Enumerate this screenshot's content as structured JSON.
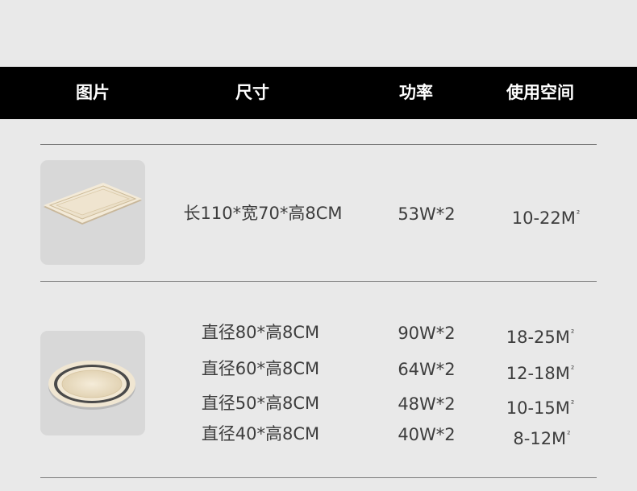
{
  "header": {
    "col_image": "图片",
    "col_size": "尺寸",
    "col_power": "功率",
    "col_space": "使用空间"
  },
  "rows": [
    {
      "image": "rectangular-ceiling-lamp",
      "variants": [
        {
          "size": "长110*宽70*高8CM",
          "power": "53W*2",
          "space": "10-22M",
          "space_unit_sup": "²"
        }
      ]
    },
    {
      "image": "round-ceiling-lamp",
      "variants": [
        {
          "size": "直径80*高8CM",
          "power": "90W*2",
          "space": "18-25M",
          "space_unit_sup": "²"
        },
        {
          "size": "直径60*高8CM",
          "power": "64W*2",
          "space": "12-18M",
          "space_unit_sup": "²"
        },
        {
          "size": "直径50*高8CM",
          "power": "48W*2",
          "space": "10-15M",
          "space_unit_sup": "²"
        },
        {
          "size": "直径40*高8CM",
          "power": "40W*2",
          "space": "8-12M",
          "space_unit_sup": "²"
        }
      ]
    }
  ]
}
